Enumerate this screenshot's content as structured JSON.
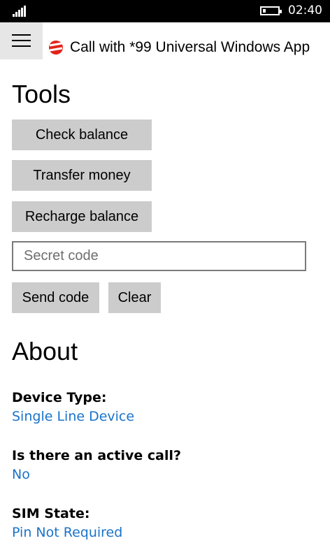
{
  "status_bar": {
    "time": "02:40"
  },
  "header": {
    "title": "Call with *99 Universal Windows App"
  },
  "tools": {
    "heading": "Tools",
    "check_balance": "Check balance",
    "transfer_money": "Transfer money",
    "recharge_balance": "Recharge balance",
    "secret_code_placeholder": "Secret code",
    "secret_code_value": "",
    "send_code": "Send code",
    "clear": "Clear"
  },
  "about": {
    "heading": "About",
    "items": [
      {
        "label": "Device Type:",
        "value": "Single Line Device"
      },
      {
        "label": "Is there an active call?",
        "value": "No"
      },
      {
        "label": "SIM State:",
        "value": "Pin Not Required"
      }
    ]
  },
  "colors": {
    "accent": "#1a73c9",
    "button_bg": "#cccccc",
    "menu_bg": "#e6e6e6",
    "logo": "#e2231a"
  }
}
